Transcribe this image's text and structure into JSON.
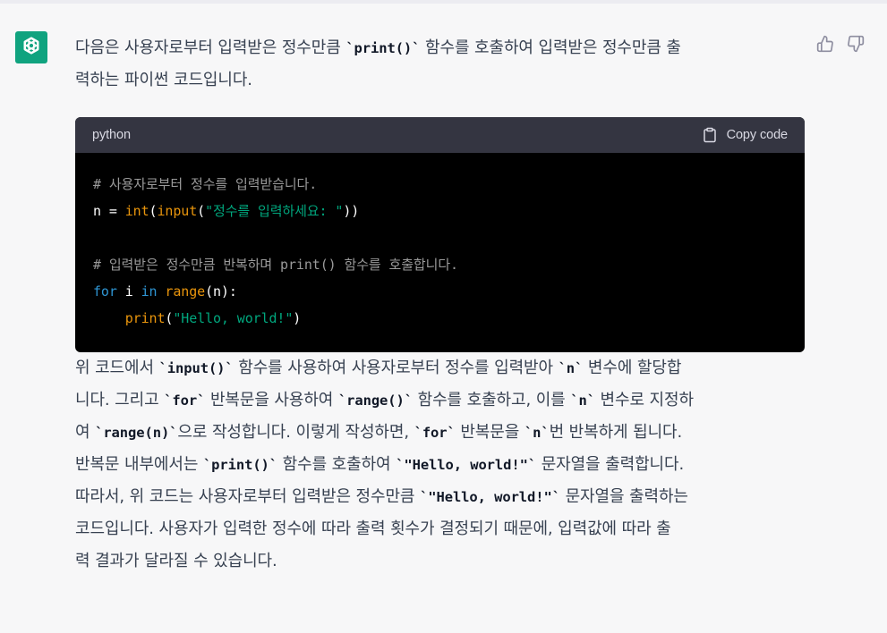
{
  "message": {
    "intro": [
      {
        "t": "text",
        "v": "다음은 사용자로부터 입력받은 정수만큼 "
      },
      {
        "t": "code",
        "v": "`print()`"
      },
      {
        "t": "text",
        "v": " 함수를 호출하여 입력받은 정수만큼 출"
      },
      {
        "t": "br"
      },
      {
        "t": "text",
        "v": "력하는 파이썬 코드입니다."
      }
    ],
    "code_block": {
      "language": "python",
      "copy_label": "Copy code",
      "lines": [
        [
          {
            "c": "cm",
            "v": "# 사용자로부터 정수를 입력받습니다."
          }
        ],
        [
          {
            "c": "",
            "v": "n = "
          },
          {
            "c": "bi",
            "v": "int"
          },
          {
            "c": "",
            "v": "("
          },
          {
            "c": "bi",
            "v": "input"
          },
          {
            "c": "",
            "v": "("
          },
          {
            "c": "st",
            "v": "\"정수를 입력하세요: \""
          },
          {
            "c": "",
            "v": "))"
          }
        ],
        [
          {
            "c": "",
            "v": ""
          }
        ],
        [
          {
            "c": "cm",
            "v": "# 입력받은 정수만큼 반복하며 print() 함수를 호출합니다."
          }
        ],
        [
          {
            "c": "kw",
            "v": "for"
          },
          {
            "c": "",
            "v": " i "
          },
          {
            "c": "kw",
            "v": "in"
          },
          {
            "c": "",
            "v": " "
          },
          {
            "c": "bi",
            "v": "range"
          },
          {
            "c": "",
            "v": "(n):"
          }
        ],
        [
          {
            "c": "",
            "v": "    "
          },
          {
            "c": "bi",
            "v": "print"
          },
          {
            "c": "",
            "v": "("
          },
          {
            "c": "st",
            "v": "\"Hello, world!\""
          },
          {
            "c": "",
            "v": ")"
          }
        ]
      ]
    },
    "explanation": [
      {
        "t": "text",
        "v": "위 코드에서 "
      },
      {
        "t": "code",
        "v": "`input()`"
      },
      {
        "t": "text",
        "v": " 함수를 사용하여 사용자로부터 정수를 입력받아 "
      },
      {
        "t": "code",
        "v": "`n`"
      },
      {
        "t": "text",
        "v": " 변수에 할당합"
      },
      {
        "t": "br"
      },
      {
        "t": "text",
        "v": "니다. 그리고 "
      },
      {
        "t": "code",
        "v": "`for`"
      },
      {
        "t": "text",
        "v": " 반복문을 사용하여 "
      },
      {
        "t": "code",
        "v": "`range()`"
      },
      {
        "t": "text",
        "v": " 함수를 호출하고, 이를 "
      },
      {
        "t": "code",
        "v": "`n`"
      },
      {
        "t": "text",
        "v": " 변수로 지정하"
      },
      {
        "t": "br"
      },
      {
        "t": "text",
        "v": "여 "
      },
      {
        "t": "code",
        "v": "`range(n)`"
      },
      {
        "t": "text",
        "v": "으로 작성합니다. 이렇게 작성하면, "
      },
      {
        "t": "code",
        "v": "`for`"
      },
      {
        "t": "text",
        "v": " 반복문을 "
      },
      {
        "t": "code",
        "v": "`n`"
      },
      {
        "t": "text",
        "v": "번 반복하게 됩니다."
      },
      {
        "t": "br"
      },
      {
        "t": "text",
        "v": "반복문 내부에서는 "
      },
      {
        "t": "code",
        "v": "`print()`"
      },
      {
        "t": "text",
        "v": " 함수를 호출하여 "
      },
      {
        "t": "code",
        "v": "`\"Hello, world!\"`"
      },
      {
        "t": "text",
        "v": " 문자열을 출력합니다."
      }
    ],
    "conclusion": [
      {
        "t": "text",
        "v": "따라서, 위 코드는 사용자로부터 입력받은 정수만큼 "
      },
      {
        "t": "code",
        "v": "`\"Hello, world!\"`"
      },
      {
        "t": "text",
        "v": " 문자열을 출력하는"
      },
      {
        "t": "br"
      },
      {
        "t": "text",
        "v": "코드입니다. 사용자가 입력한 정수에 따라 출력 횟수가 결정되기 때문에, 입력값에 따라 출"
      },
      {
        "t": "br"
      },
      {
        "t": "text",
        "v": "력 결과가 달라질 수 있습니다."
      }
    ]
  },
  "icons": {
    "avatar": "openai-logo-icon",
    "copy": "clipboard-icon",
    "like": "thumbs-up-icon",
    "dislike": "thumbs-down-icon"
  },
  "colors": {
    "avatar_bg": "#10a37f",
    "code_header_bg": "#343541",
    "code_bg": "#000000",
    "comment": "#9a9a9a",
    "keyword": "#2e95d3",
    "builtin": "#e9950c",
    "string": "#00a67d"
  }
}
